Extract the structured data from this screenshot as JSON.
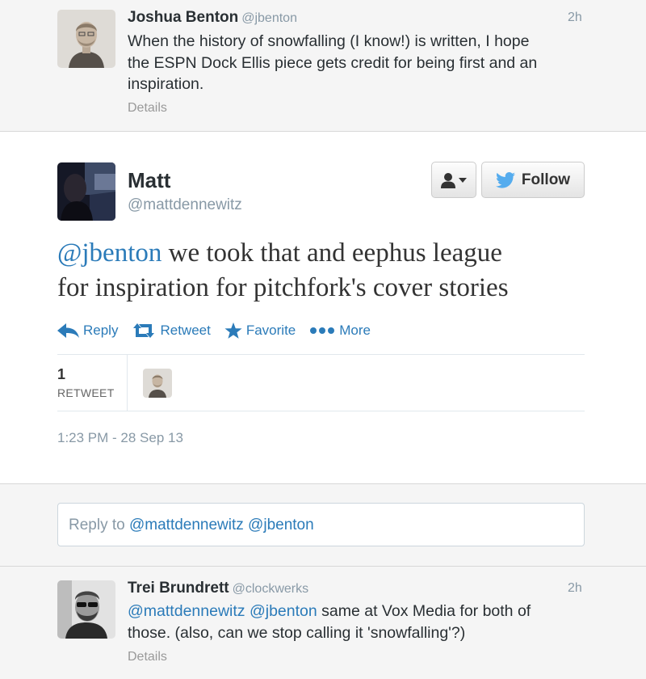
{
  "top_tweet": {
    "name": "Joshua Benton",
    "handle": "@jbenton",
    "time": "2h",
    "text_lines": [
      "When the history of snowfalling (I know!) is written, I hope",
      "the ESPN Dock Ellis piece gets credit for being first and an",
      "inspiration."
    ],
    "details": "Details"
  },
  "main_tweet": {
    "name": "Matt",
    "handle": "@mattdennewitz",
    "follow_label": "Follow",
    "mention": "@jbenton",
    "text_line1_rest": " we took that and eephus league",
    "text_line2": "for inspiration for pitchfork's cover stories",
    "actions": {
      "reply": "Reply",
      "retweet": "Retweet",
      "favorite": "Favorite",
      "more": "More"
    },
    "retweet_count": "1",
    "retweet_label": "RETWEET",
    "timestamp": "1:23 PM - 28 Sep 13"
  },
  "reply_box": {
    "prefix": "Reply to ",
    "mentions": "@mattdennewitz @jbenton"
  },
  "bottom_tweet": {
    "name": "Trei Brundrett",
    "handle": "@clockwerks",
    "time": "2h",
    "mention1": "@mattdennewitz",
    "mention2": "@jbenton",
    "line1_rest": " same at Vox Media for both of",
    "line2": "those. (also, can we stop calling it 'snowfalling'?)",
    "details": "Details"
  },
  "colors": {
    "link": "#2b7bb9",
    "twitter_bird": "#55acee",
    "panel_bg": "#f5f5f5"
  },
  "icons": [
    "user-icon",
    "chevron-down-icon",
    "twitter-bird-icon",
    "reply-icon",
    "retweet-icon",
    "star-icon",
    "ellipsis-icon"
  ]
}
